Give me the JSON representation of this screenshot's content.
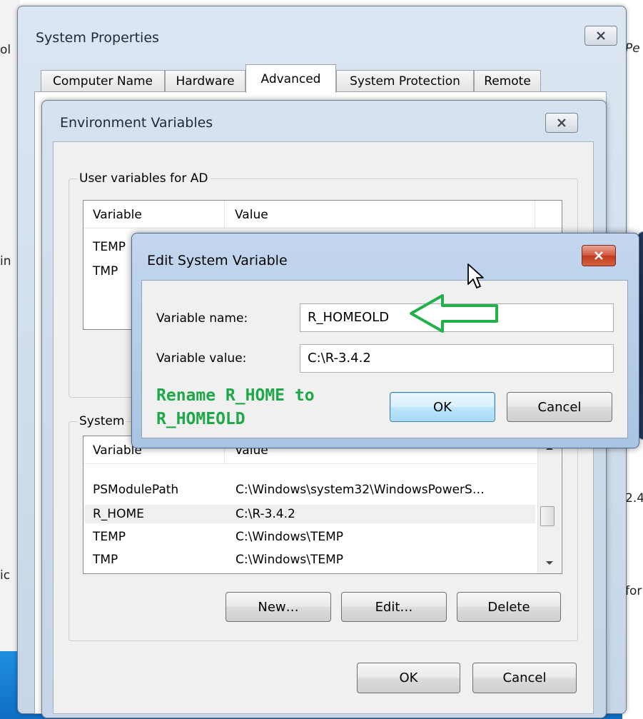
{
  "background": {
    "left_fragments": [
      "ol",
      "in",
      "ic"
    ],
    "right_fragments": [
      "Pe",
      "2.4",
      "for"
    ]
  },
  "system_properties": {
    "title": "System Properties",
    "tabs": [
      {
        "label": "Computer Name",
        "active": false
      },
      {
        "label": "Hardware",
        "active": false
      },
      {
        "label": "Advanced",
        "active": true
      },
      {
        "label": "System Protection",
        "active": false
      },
      {
        "label": "Remote",
        "active": false
      }
    ]
  },
  "environment_variables": {
    "title": "Environment Variables",
    "user_group_title": "User variables for AD",
    "user_columns": [
      "Variable",
      "Value"
    ],
    "user_rows": [
      {
        "variable": "TEMP",
        "value": ""
      },
      {
        "variable": "TMP",
        "value": ""
      }
    ],
    "system_group_title": "System",
    "system_columns": [
      "Variable",
      "Value"
    ],
    "system_rows": [
      {
        "variable": "PSModulePath",
        "value": "C:\\Windows\\system32\\WindowsPowerS…",
        "selected": false
      },
      {
        "variable": "R_HOME",
        "value": "C:\\R-3.4.2",
        "selected": true
      },
      {
        "variable": "TEMP",
        "value": "C:\\Windows\\TEMP",
        "selected": false
      },
      {
        "variable": "TMP",
        "value": "C:\\Windows\\TEMP",
        "selected": false
      }
    ],
    "buttons": {
      "new": "New…",
      "edit": "Edit…",
      "delete": "Delete"
    },
    "ok": "OK",
    "cancel": "Cancel"
  },
  "edit_system_variable": {
    "title": "Edit System Variable",
    "name_label": "Variable name:",
    "name_value": "R_HOMEOLD",
    "value_label": "Variable value:",
    "value_value": "C:\\R-3.4.2",
    "ok": "OK",
    "cancel": "Cancel"
  },
  "annotation": {
    "text_line1": "Rename R_HOME to",
    "text_line2": "R_HOMEOLD",
    "color": "#1fa84a"
  },
  "icons": [
    "close-icon",
    "mouse-cursor-icon",
    "arrow-annotation-icon",
    "scroll-up-arrow-icon",
    "scroll-down-arrow-icon"
  ]
}
